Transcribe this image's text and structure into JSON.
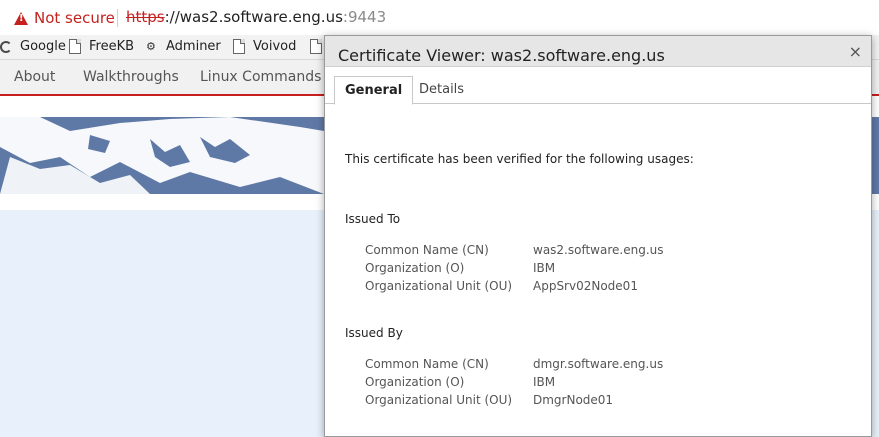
{
  "browser": {
    "security_label": "Not secure",
    "url_protocol": "https",
    "url_sep": "://",
    "url_host": "was2.software.eng.us",
    "url_port": ":9443"
  },
  "bookmarks": [
    {
      "label": "Google",
      "icon": "google-icon"
    },
    {
      "label": "FreeKB",
      "icon": "page-icon"
    },
    {
      "label": "Adminer",
      "icon": "adminer-icon"
    },
    {
      "label": "Voivod",
      "icon": "page-icon"
    }
  ],
  "site_nav": [
    "About",
    "Walkthroughs",
    "Linux Commands"
  ],
  "dialog": {
    "title": "Certificate Viewer: was2.software.eng.us",
    "close": "×",
    "tabs": [
      "General",
      "Details"
    ],
    "verified_text": "This certificate has been verified for the following usages:",
    "issued_to": {
      "heading": "Issued To",
      "rows": [
        {
          "label": "Common Name (CN)",
          "value": "was2.software.eng.us"
        },
        {
          "label": "Organization (O)",
          "value": "IBM"
        },
        {
          "label": "Organizational Unit (OU)",
          "value": "AppSrv02Node01"
        }
      ]
    },
    "issued_by": {
      "heading": "Issued By",
      "rows": [
        {
          "label": "Common Name (CN)",
          "value": "dmgr.software.eng.us"
        },
        {
          "label": "Organization (O)",
          "value": "IBM"
        },
        {
          "label": "Organizational Unit (OU)",
          "value": "DmgrNode01"
        }
      ]
    }
  }
}
